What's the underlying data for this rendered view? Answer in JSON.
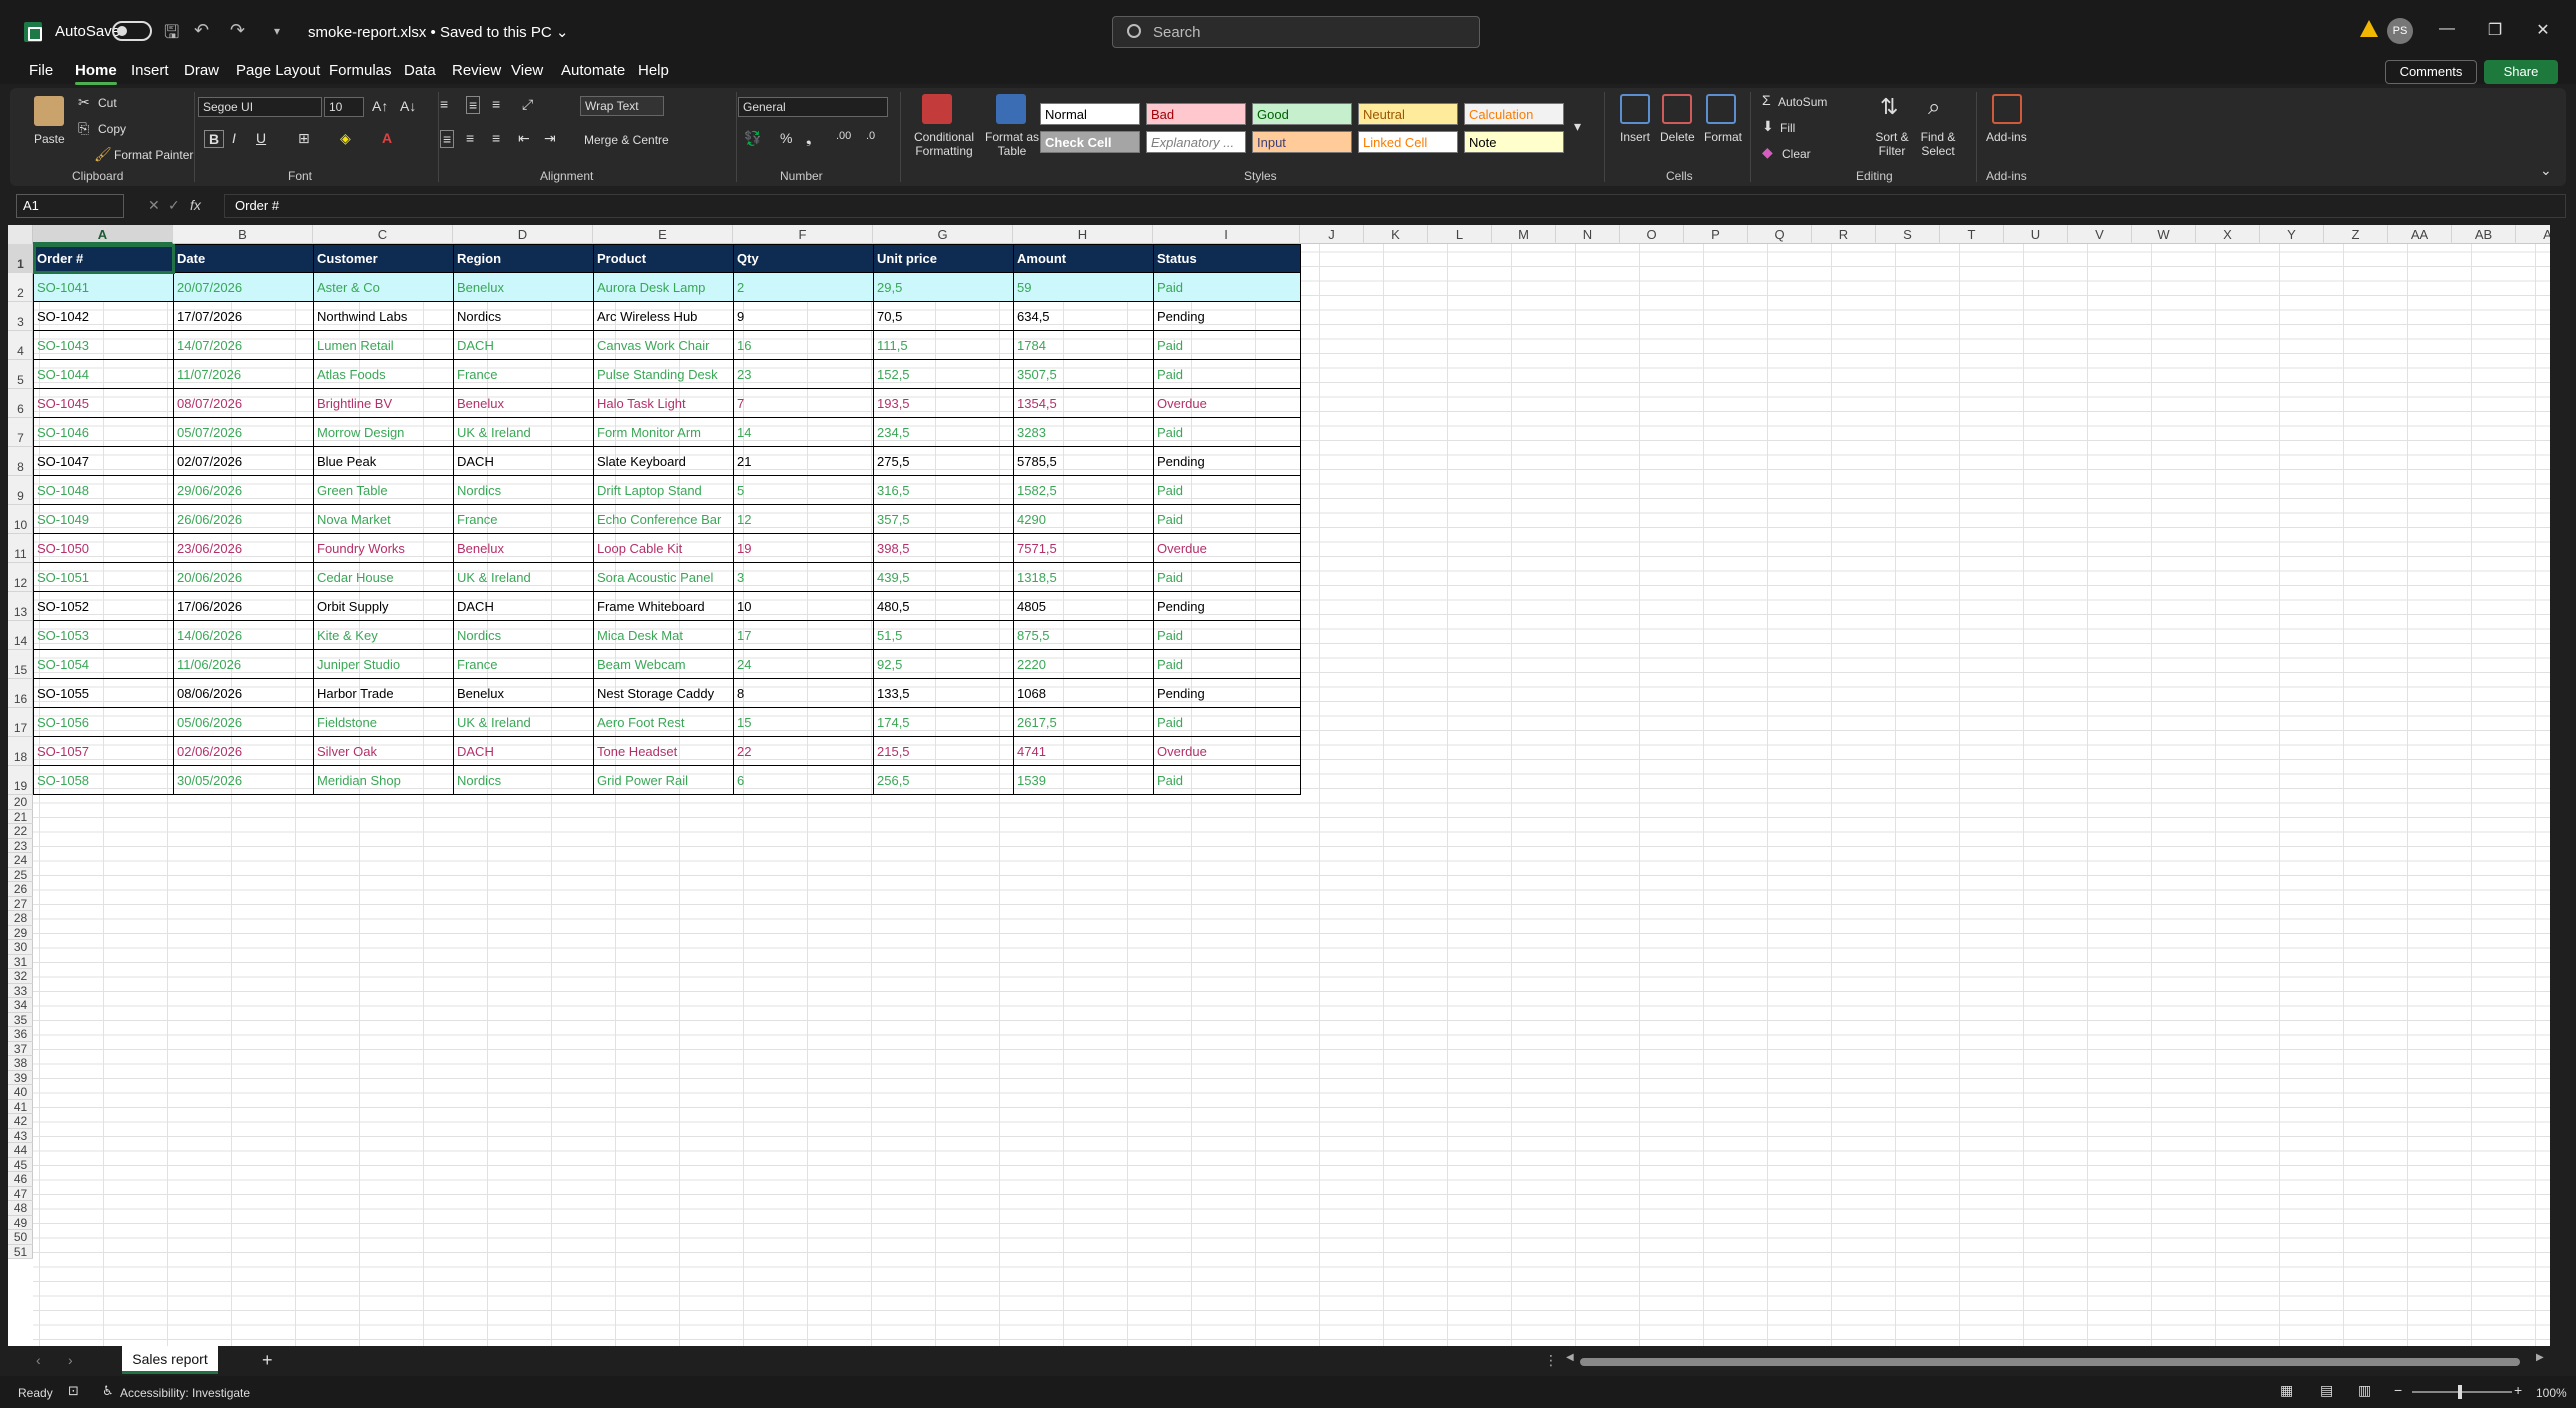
{
  "titlebar": {
    "autosave_label": "AutoSave",
    "doc_title": "smoke-report.xlsx • Saved to this PC ⌄",
    "search_placeholder": "Search",
    "avatar_initials": "PS"
  },
  "menu": {
    "tabs": [
      "File",
      "Home",
      "Insert",
      "Draw",
      "Page Layout",
      "Formulas",
      "Data",
      "Review",
      "View",
      "Automate",
      "Help"
    ],
    "active": "Home",
    "comments_label": "Comments",
    "share_label": "Share"
  },
  "ribbon": {
    "clipboard": {
      "paste": "Paste",
      "cut": "Cut",
      "copy": "Copy",
      "format_painter": "Format Painter",
      "group": "Clipboard"
    },
    "font": {
      "family": "Segoe UI",
      "size": "10",
      "group": "Font"
    },
    "alignment": {
      "wrap_text": "Wrap Text",
      "merge": "Merge & Centre",
      "group": "Alignment"
    },
    "number": {
      "format": "General",
      "group": "Number"
    },
    "styles": {
      "conditional": "Conditional Formatting",
      "format_table": "Format as Table",
      "cells": [
        {
          "label": "Normal",
          "bg": "#ffffff",
          "fg": "#000000"
        },
        {
          "label": "Bad",
          "bg": "#ffc7ce",
          "fg": "#9c0006"
        },
        {
          "label": "Good",
          "bg": "#c6efce",
          "fg": "#006100"
        },
        {
          "label": "Neutral",
          "bg": "#ffeb9c",
          "fg": "#9c5700"
        },
        {
          "label": "Calculation",
          "bg": "#f2f2f2",
          "fg": "#fa7d00"
        },
        {
          "label": "Check Cell",
          "bg": "#a5a5a5",
          "fg": "#ffffff"
        },
        {
          "label": "Explanatory ...",
          "bg": "#ffffff",
          "fg": "#7f7f7f"
        },
        {
          "label": "Input",
          "bg": "#ffcc99",
          "fg": "#3f3f76"
        },
        {
          "label": "Linked Cell",
          "bg": "#ffffff",
          "fg": "#fa7d00"
        },
        {
          "label": "Note",
          "bg": "#ffffcc",
          "fg": "#000000"
        }
      ],
      "group": "Styles"
    },
    "cells_group": {
      "insert": "Insert",
      "delete": "Delete",
      "format": "Format",
      "group": "Cells"
    },
    "editing": {
      "autosum": "AutoSum",
      "fill": "Fill",
      "clear": "Clear",
      "sort": "Sort & Filter",
      "find": "Find & Select",
      "group": "Editing"
    },
    "addins": {
      "label": "Add-ins",
      "group": "Add-ins"
    }
  },
  "formula_bar": {
    "cell_ref": "A1",
    "fx": "fx",
    "content": "Order #"
  },
  "columns": [
    "A",
    "B",
    "C",
    "D",
    "E",
    "F",
    "G",
    "H",
    "I",
    "J",
    "K",
    "L",
    "M",
    "N",
    "O",
    "P",
    "Q",
    "R",
    "S",
    "T",
    "U",
    "V",
    "W",
    "X",
    "Y",
    "Z",
    "AA",
    "AB",
    "A"
  ],
  "headers": [
    "Order #",
    "Date",
    "Customer",
    "Region",
    "Product",
    "Qty",
    "Unit price",
    "Amount",
    "Status"
  ],
  "rows": [
    {
      "cells": [
        "SO-1041",
        "20/07/2026",
        "Aster & Co",
        "Benelux",
        "Aurora Desk Lamp",
        "2",
        "29,5",
        "59",
        "Paid"
      ],
      "status": "paid"
    },
    {
      "cells": [
        "SO-1042",
        "17/07/2026",
        "Northwind Labs",
        "Nordics",
        "Arc Wireless Hub",
        "9",
        "70,5",
        "634,5",
        "Pending"
      ],
      "status": "pending"
    },
    {
      "cells": [
        "SO-1043",
        "14/07/2026",
        "Lumen Retail",
        "DACH",
        "Canvas Work Chair",
        "16",
        "111,5",
        "1784",
        "Paid"
      ],
      "status": "paid"
    },
    {
      "cells": [
        "SO-1044",
        "11/07/2026",
        "Atlas Foods",
        "France",
        "Pulse Standing Desk",
        "23",
        "152,5",
        "3507,5",
        "Paid"
      ],
      "status": "paid"
    },
    {
      "cells": [
        "SO-1045",
        "08/07/2026",
        "Brightline BV",
        "Benelux",
        "Halo Task Light",
        "7",
        "193,5",
        "1354,5",
        "Overdue"
      ],
      "status": "overdue"
    },
    {
      "cells": [
        "SO-1046",
        "05/07/2026",
        "Morrow Design",
        "UK & Ireland",
        "Form Monitor Arm",
        "14",
        "234,5",
        "3283",
        "Paid"
      ],
      "status": "paid"
    },
    {
      "cells": [
        "SO-1047",
        "02/07/2026",
        "Blue Peak",
        "DACH",
        "Slate Keyboard",
        "21",
        "275,5",
        "5785,5",
        "Pending"
      ],
      "status": "pending"
    },
    {
      "cells": [
        "SO-1048",
        "29/06/2026",
        "Green Table",
        "Nordics",
        "Drift Laptop Stand",
        "5",
        "316,5",
        "1582,5",
        "Paid"
      ],
      "status": "paid"
    },
    {
      "cells": [
        "SO-1049",
        "26/06/2026",
        "Nova Market",
        "France",
        "Echo Conference Bar",
        "12",
        "357,5",
        "4290",
        "Paid"
      ],
      "status": "paid"
    },
    {
      "cells": [
        "SO-1050",
        "23/06/2026",
        "Foundry Works",
        "Benelux",
        "Loop Cable Kit",
        "19",
        "398,5",
        "7571,5",
        "Overdue"
      ],
      "status": "overdue"
    },
    {
      "cells": [
        "SO-1051",
        "20/06/2026",
        "Cedar House",
        "UK & Ireland",
        "Sora Acoustic Panel",
        "3",
        "439,5",
        "1318,5",
        "Paid"
      ],
      "status": "paid"
    },
    {
      "cells": [
        "SO-1052",
        "17/06/2026",
        "Orbit Supply",
        "DACH",
        "Frame Whiteboard",
        "10",
        "480,5",
        "4805",
        "Pending"
      ],
      "status": "pending"
    },
    {
      "cells": [
        "SO-1053",
        "14/06/2026",
        "Kite & Key",
        "Nordics",
        "Mica Desk Mat",
        "17",
        "51,5",
        "875,5",
        "Paid"
      ],
      "status": "paid"
    },
    {
      "cells": [
        "SO-1054",
        "11/06/2026",
        "Juniper Studio",
        "France",
        "Beam Webcam",
        "24",
        "92,5",
        "2220",
        "Paid"
      ],
      "status": "paid"
    },
    {
      "cells": [
        "SO-1055",
        "08/06/2026",
        "Harbor Trade",
        "Benelux",
        "Nest Storage Caddy",
        "8",
        "133,5",
        "1068",
        "Pending"
      ],
      "status": "pending"
    },
    {
      "cells": [
        "SO-1056",
        "05/06/2026",
        "Fieldstone",
        "UK & Ireland",
        "Aero Foot Rest",
        "15",
        "174,5",
        "2617,5",
        "Paid"
      ],
      "status": "paid"
    },
    {
      "cells": [
        "SO-1057",
        "02/06/2026",
        "Silver Oak",
        "DACH",
        "Tone Headset",
        "22",
        "215,5",
        "4741",
        "Overdue"
      ],
      "status": "overdue"
    },
    {
      "cells": [
        "SO-1058",
        "30/05/2026",
        "Meridian Shop",
        "Nordics",
        "Grid Power Rail",
        "6",
        "256,5",
        "1539",
        "Paid"
      ],
      "status": "paid"
    }
  ],
  "status_colors": {
    "paid": "#3aa757",
    "pending": "#000000",
    "overdue": "#b4306a"
  },
  "sheet_tabs": {
    "active": "Sales report",
    "add": "+"
  },
  "statusbar": {
    "ready": "Ready",
    "accessibility": "Accessibility: Investigate",
    "zoom": "100%"
  }
}
